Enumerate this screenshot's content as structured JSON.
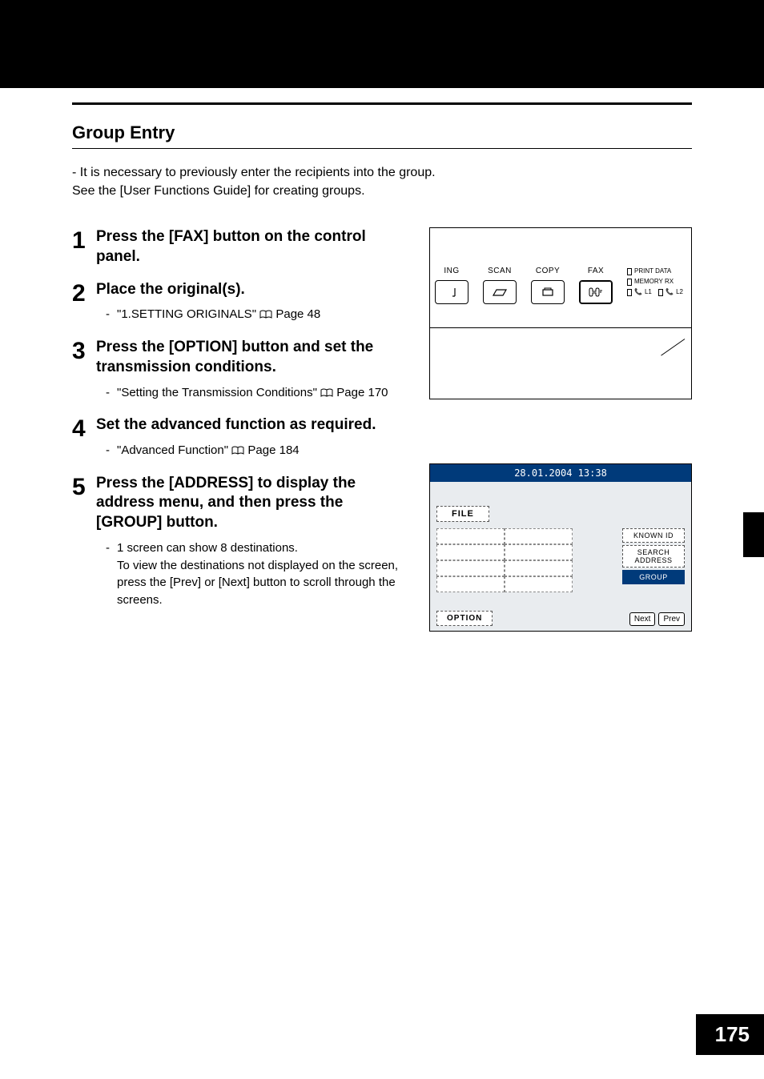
{
  "page_number": "175",
  "section_title": "Group Entry",
  "intro_line1_prefix": "- ",
  "intro_line1": "It is necessary to previously enter the recipients into the group.",
  "intro_line2": "See the [User Functions Guide] for creating groups.",
  "steps": {
    "s1": {
      "num": "1",
      "title": "Press the [FAX] button on the control panel."
    },
    "s2": {
      "num": "2",
      "title": "Place the original(s).",
      "sub_prefix": "- ",
      "sub_text": "\"1.SETTING ORIGINALS\" ",
      "sub_page": "Page 48"
    },
    "s3": {
      "num": "3",
      "title": "Press the [OPTION] button and set the transmission conditions.",
      "sub_prefix": "- ",
      "sub_text": "\"Setting the Transmission Conditions\" ",
      "sub_page": "Page 170"
    },
    "s4": {
      "num": "4",
      "title": "Set the advanced function as required.",
      "sub_prefix": "- ",
      "sub_text": "\"Advanced Function\" ",
      "sub_page": "Page 184"
    },
    "s5": {
      "num": "5",
      "title": "Press the [ADDRESS] to display the address menu, and then press the [GROUP] button.",
      "sub_prefix": "- ",
      "sub_line1": "1 screen can show 8 destinations.",
      "sub_line2": "To view the destinations not displayed on the screen, press the [Prev] or [Next] button to scroll through the screens."
    }
  },
  "panel": {
    "ing": "ING",
    "scan": "SCAN",
    "copy": "COPY",
    "fax": "FAX",
    "print_data": "PRINT DATA",
    "memory_rx": "MEMORY RX",
    "l1": "L1",
    "l2": "L2"
  },
  "touchscreen": {
    "datetime": "28.01.2004 13:38",
    "file": "FILE",
    "known_id": "KNOWN ID",
    "search_address": "SEARCH ADDRESS",
    "group": "GROUP",
    "option": "OPTION",
    "next": "Next",
    "prev": "Prev"
  }
}
